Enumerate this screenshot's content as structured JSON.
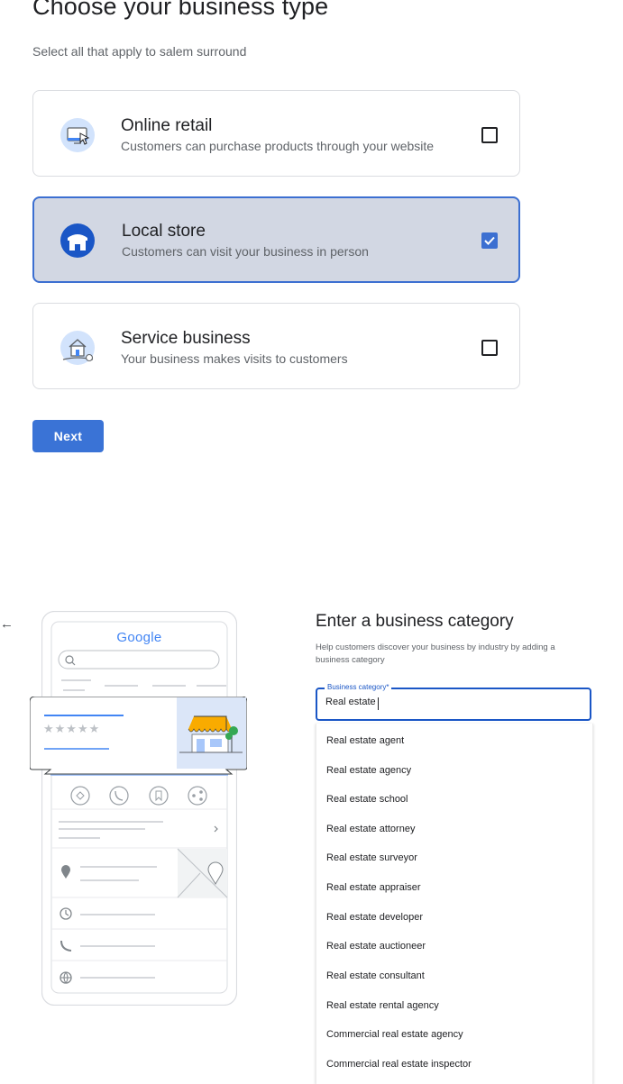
{
  "header": {
    "title": "Choose your business type",
    "subtitle": "Select all that apply to salem surround"
  },
  "business_types": [
    {
      "title": "Online retail",
      "description": "Customers can purchase products through your website",
      "checked": false,
      "icon": "computer-cursor-icon"
    },
    {
      "title": "Local store",
      "description": "Customers can visit your business in person",
      "checked": true,
      "icon": "storefront-icon"
    },
    {
      "title": "Service business",
      "description": "Your business makes visits to customers",
      "checked": false,
      "icon": "house-location-icon"
    }
  ],
  "next_label": "Next",
  "back_icon": "arrow-left-icon",
  "phone_preview": {
    "brand": "Google",
    "rating_stars": 5
  },
  "category_panel": {
    "title": "Enter a business category",
    "help": "Help customers discover your business by industry by adding a business category",
    "field_label": "Business category*",
    "field_value": "Real estate",
    "options": [
      "Real estate agent",
      "Real estate agency",
      "Real estate school",
      "Real estate attorney",
      "Real estate surveyor",
      "Real estate appraiser",
      "Real estate developer",
      "Real estate auctioneer",
      "Real estate consultant",
      "Real estate rental agency",
      "Commercial real estate agency",
      "Commercial real estate inspector"
    ]
  },
  "colors": {
    "accent": "#3a73d6",
    "selected_bg": "#d2d7e3",
    "selected_border": "#3c6fd1",
    "focus_blue": "#1a56c6"
  }
}
